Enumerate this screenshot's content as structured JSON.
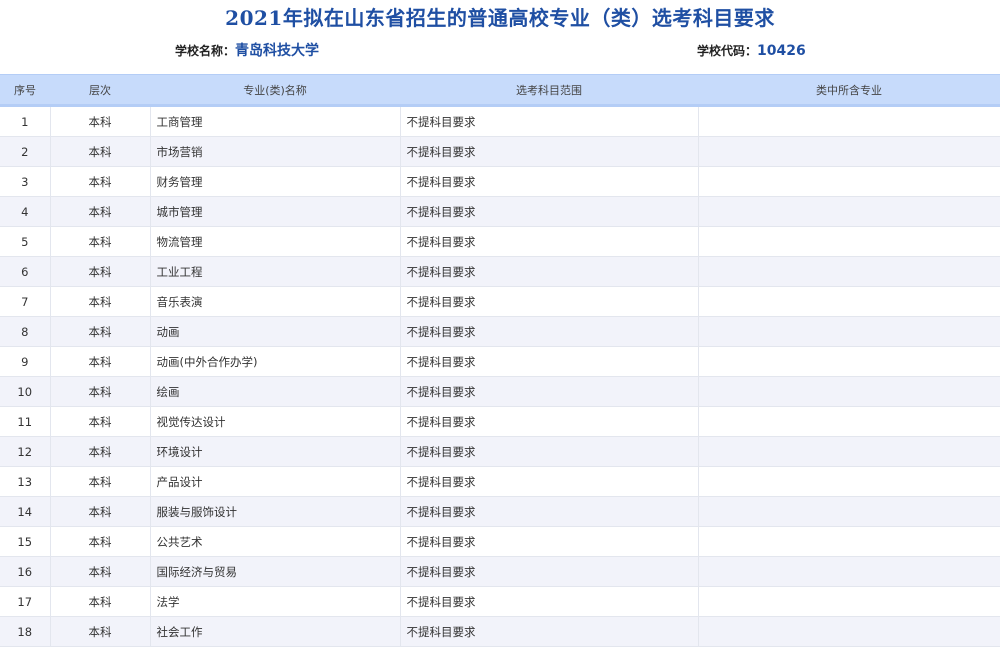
{
  "title": "2021年拟在山东省招生的普通高校专业（类）选考科目要求",
  "school": {
    "name_label": "学校名称：",
    "name": "青岛科技大学",
    "code_label": "学校代码：",
    "code": "10426"
  },
  "table": {
    "headers": [
      "序号",
      "层次",
      "专业(类)名称",
      "选考科目范围",
      "类中所含专业"
    ],
    "rows": [
      {
        "no": "1",
        "level": "本科",
        "major": "工商管理",
        "requirement": "不提科目要求",
        "included": ""
      },
      {
        "no": "2",
        "level": "本科",
        "major": "市场营销",
        "requirement": "不提科目要求",
        "included": ""
      },
      {
        "no": "3",
        "level": "本科",
        "major": "财务管理",
        "requirement": "不提科目要求",
        "included": ""
      },
      {
        "no": "4",
        "level": "本科",
        "major": "城市管理",
        "requirement": "不提科目要求",
        "included": ""
      },
      {
        "no": "5",
        "level": "本科",
        "major": "物流管理",
        "requirement": "不提科目要求",
        "included": ""
      },
      {
        "no": "6",
        "level": "本科",
        "major": "工业工程",
        "requirement": "不提科目要求",
        "included": ""
      },
      {
        "no": "7",
        "level": "本科",
        "major": "音乐表演",
        "requirement": "不提科目要求",
        "included": ""
      },
      {
        "no": "8",
        "level": "本科",
        "major": "动画",
        "requirement": "不提科目要求",
        "included": ""
      },
      {
        "no": "9",
        "level": "本科",
        "major": "动画(中外合作办学)",
        "requirement": "不提科目要求",
        "included": ""
      },
      {
        "no": "10",
        "level": "本科",
        "major": "绘画",
        "requirement": "不提科目要求",
        "included": ""
      },
      {
        "no": "11",
        "level": "本科",
        "major": "视觉传达设计",
        "requirement": "不提科目要求",
        "included": ""
      },
      {
        "no": "12",
        "level": "本科",
        "major": "环境设计",
        "requirement": "不提科目要求",
        "included": ""
      },
      {
        "no": "13",
        "level": "本科",
        "major": "产品设计",
        "requirement": "不提科目要求",
        "included": ""
      },
      {
        "no": "14",
        "level": "本科",
        "major": "服装与服饰设计",
        "requirement": "不提科目要求",
        "included": ""
      },
      {
        "no": "15",
        "level": "本科",
        "major": "公共艺术",
        "requirement": "不提科目要求",
        "included": ""
      },
      {
        "no": "16",
        "level": "本科",
        "major": "国际经济与贸易",
        "requirement": "不提科目要求",
        "included": ""
      },
      {
        "no": "17",
        "level": "本科",
        "major": "法学",
        "requirement": "不提科目要求",
        "included": ""
      },
      {
        "no": "18",
        "level": "本科",
        "major": "社会工作",
        "requirement": "不提科目要求",
        "included": ""
      }
    ]
  }
}
